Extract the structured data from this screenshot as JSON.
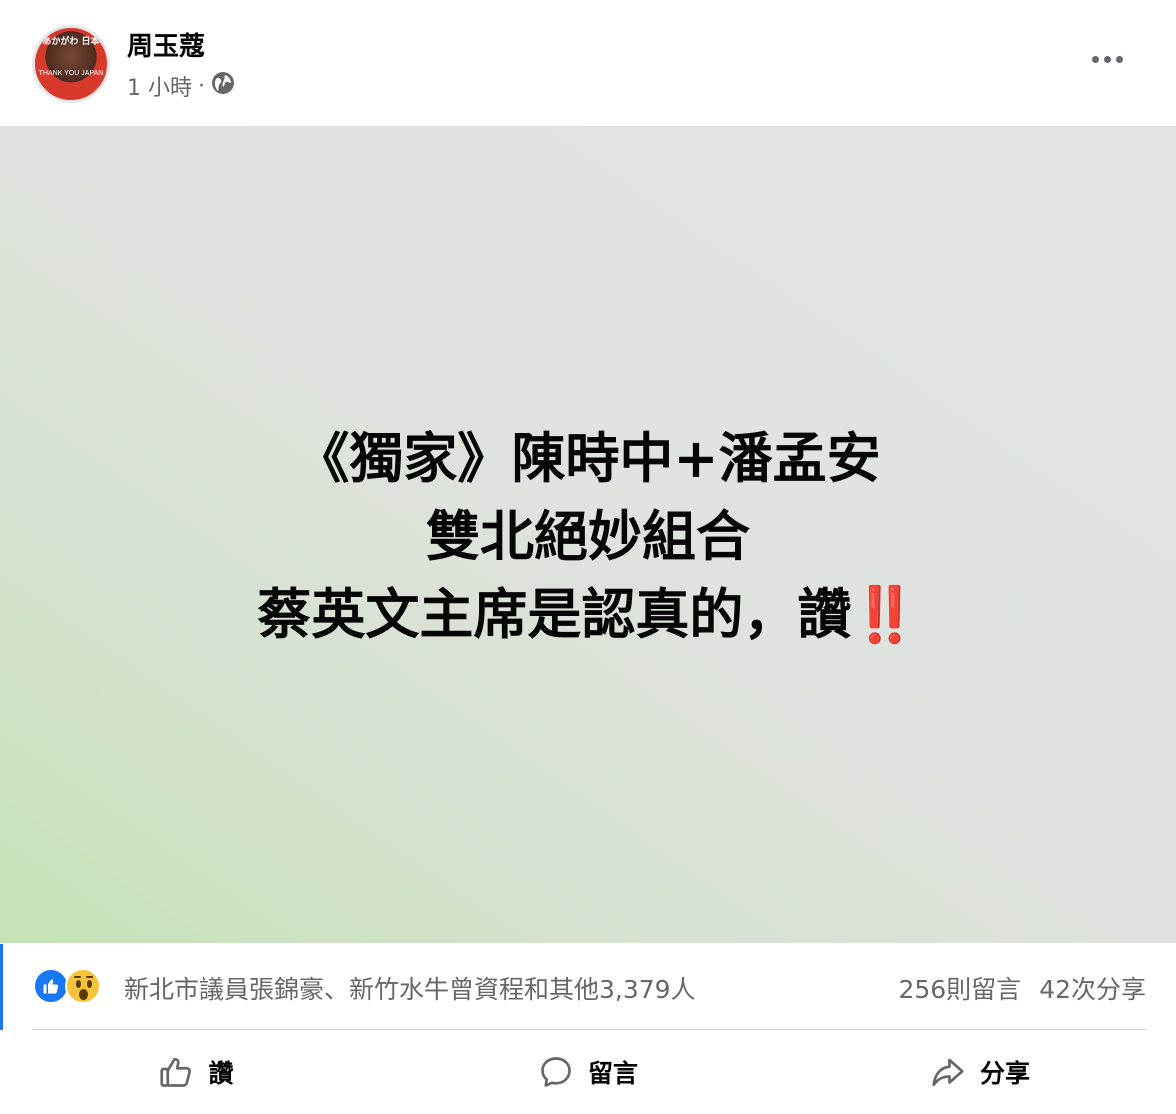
{
  "post": {
    "author": "周玉蔻",
    "time": "1 小時",
    "separator": "·",
    "avatar_text_top": "あかがわ 日本",
    "avatar_text_center": "THANK YOU JAPAN",
    "content_lines": [
      "《獨家》陳時中+潘孟安",
      "雙北絕妙組合",
      "蔡英文主席是認真的，讚"
    ],
    "content_emoji": "‼️"
  },
  "stats": {
    "reactors": "新北市議員張錦豪、新竹水牛曾資程和其他3,379人",
    "comments": "256則留言",
    "shares": "42次分享"
  },
  "actions": {
    "like": "讚",
    "comment": "留言",
    "share": "分享"
  },
  "icons": {
    "more": "more-dots-icon",
    "privacy": "globe-icon",
    "like_reaction": "like-reaction-icon",
    "wow_reaction": "wow-reaction-icon",
    "like": "thumbs-up-icon",
    "comment": "comment-bubble-icon",
    "share": "share-arrow-icon"
  },
  "colors": {
    "accent": "#1877f2",
    "secondary_text": "#65676b",
    "emoji_red": "#dd2e44"
  }
}
